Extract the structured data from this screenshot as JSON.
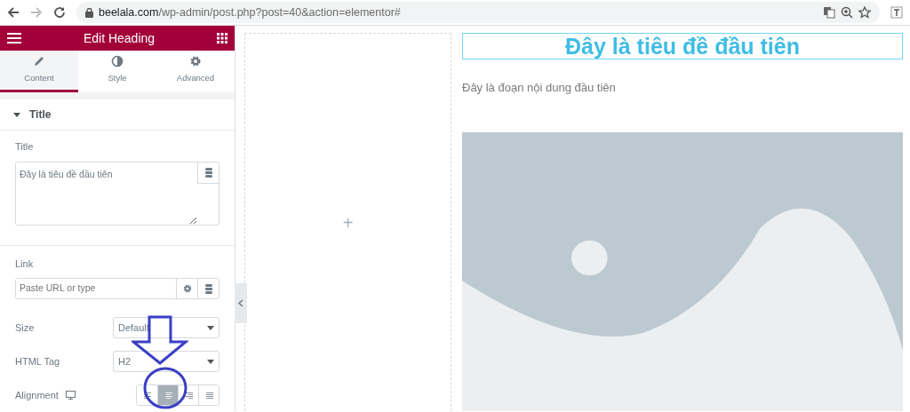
{
  "browser": {
    "url_host": "beelala.com",
    "url_path": "/wp-admin/post.php?post=40&action=elementor#"
  },
  "panel": {
    "title": "Edit Heading",
    "tabs": [
      {
        "label": "Content",
        "selected": true
      },
      {
        "label": "Style",
        "selected": false
      },
      {
        "label": "Advanced",
        "selected": false
      }
    ],
    "section": {
      "title": "Title",
      "expanded": true
    },
    "title_field": {
      "label": "Title",
      "value": "Đây là tiêu đề đầu tiên"
    },
    "link_field": {
      "label": "Link",
      "placeholder": "Paste URL or type"
    },
    "size": {
      "label": "Size",
      "value": "Default"
    },
    "html_tag": {
      "label": "HTML Tag",
      "value": "H2"
    },
    "alignment": {
      "label": "Alignment",
      "options": [
        {
          "kind": "left",
          "selected": false
        },
        {
          "kind": "center",
          "selected": true
        },
        {
          "kind": "right",
          "selected": false
        },
        {
          "kind": "justify",
          "selected": false
        }
      ]
    }
  },
  "canvas": {
    "empty_column": {
      "add": "+"
    },
    "heading": "Đây là tiêu đề đầu tiên",
    "paragraph": "Đây là đoạn nội dung đầu tiên"
  }
}
